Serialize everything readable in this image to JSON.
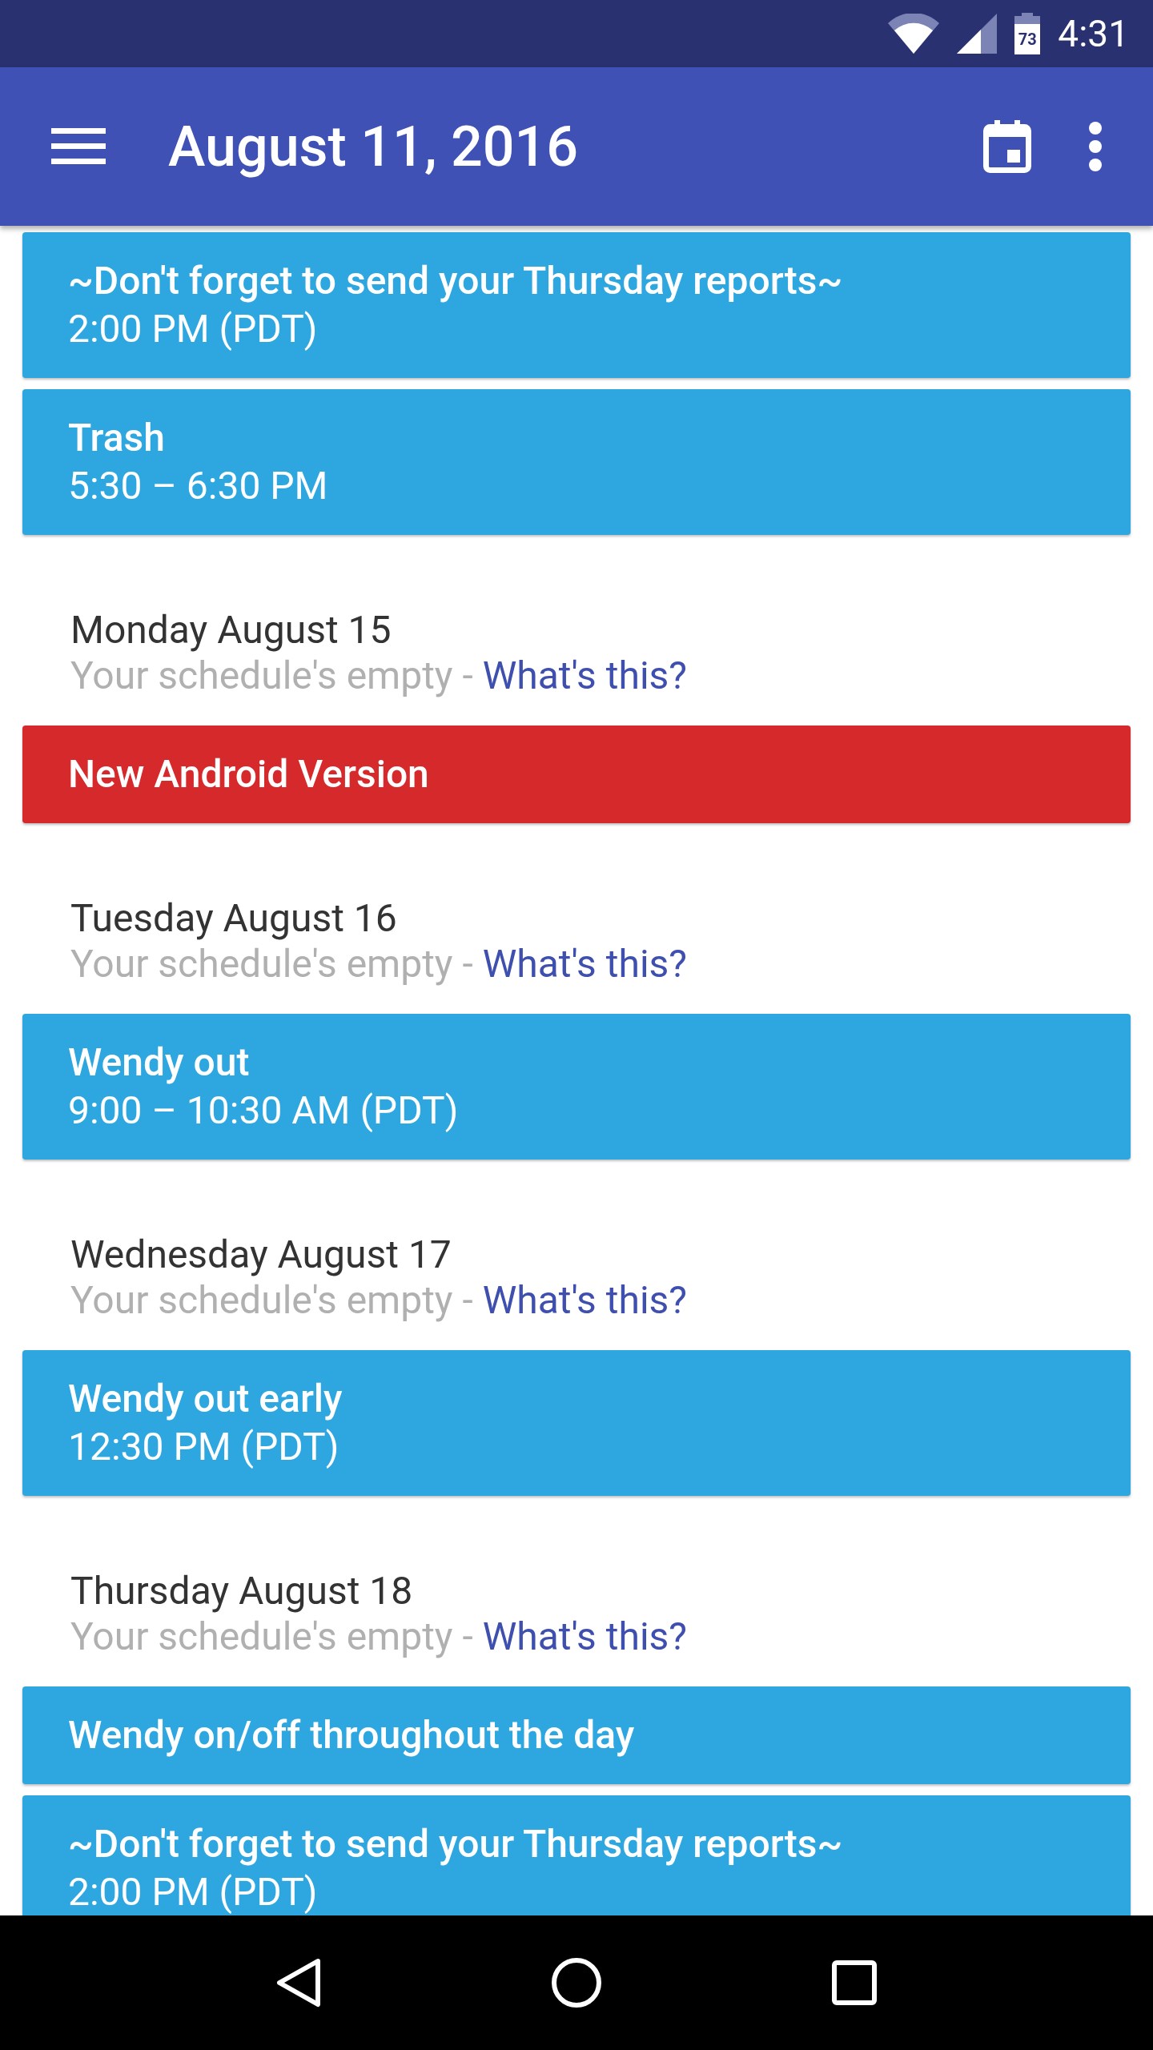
{
  "status_bar": {
    "battery": "73",
    "time": "4:31"
  },
  "app_bar": {
    "title": "August 11, 2016"
  },
  "agenda": [
    {
      "kind": "event",
      "title": "~Don't forget to send your Thursday reports~",
      "time": "2:00 PM (PDT)",
      "color": "#2ea7e0"
    },
    {
      "kind": "event",
      "title": "Trash",
      "time": "5:30 – 6:30 PM",
      "color": "#2ea7e0"
    },
    {
      "kind": "day",
      "heading": "Monday August 15",
      "empty": "Your schedule's empty -",
      "link": "What's this?"
    },
    {
      "kind": "event",
      "title": "New Android Version",
      "color": "#d6292b"
    },
    {
      "kind": "day",
      "heading": "Tuesday August 16",
      "empty": "Your schedule's empty -",
      "link": "What's this?"
    },
    {
      "kind": "event",
      "title": "Wendy out",
      "time": "9:00 – 10:30 AM (PDT)",
      "color": "#2ea7e0"
    },
    {
      "kind": "day",
      "heading": "Wednesday August 17",
      "empty": "Your schedule's empty -",
      "link": "What's this?"
    },
    {
      "kind": "event",
      "title": "Wendy out early",
      "time": "12:30 PM (PDT)",
      "color": "#2ea7e0"
    },
    {
      "kind": "day",
      "heading": "Thursday August 18",
      "empty": "Your schedule's empty -",
      "link": "What's this?"
    },
    {
      "kind": "event",
      "title": "Wendy on/off throughout the day",
      "color": "#2ea7e0"
    },
    {
      "kind": "event",
      "title": "~Don't forget to send your Thursday reports~",
      "time": "2:00 PM (PDT)",
      "color": "#2ea7e0"
    }
  ]
}
